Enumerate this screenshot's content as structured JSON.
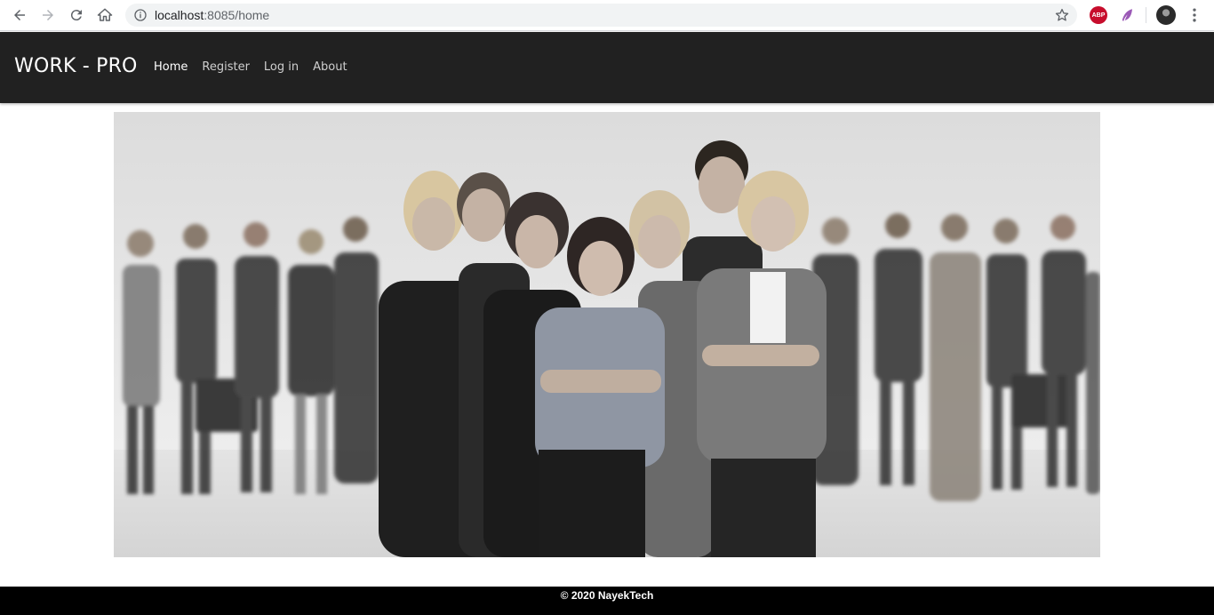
{
  "browser": {
    "url_host": "localhost",
    "url_rest": ":8085/home",
    "extensions": [
      {
        "name": "adblock-plus",
        "badge": "ABP",
        "color": "#c70d2c"
      },
      {
        "name": "feather-extension",
        "color": "#8e44ad"
      }
    ]
  },
  "navbar": {
    "brand": "WORK - PRO",
    "links": [
      {
        "label": "Home",
        "active": true
      },
      {
        "label": "Register",
        "active": false
      },
      {
        "label": "Log in",
        "active": false
      },
      {
        "label": "About",
        "active": false
      }
    ]
  },
  "hero": {
    "description_color_scheme": "grayscale"
  },
  "footer": {
    "text": "© 2020 NayekTech"
  },
  "colors": {
    "navbar_bg": "#212121",
    "footer_bg": "#000000",
    "nav_active": "#ffffff",
    "nav_inactive": "#cfcfcf"
  }
}
